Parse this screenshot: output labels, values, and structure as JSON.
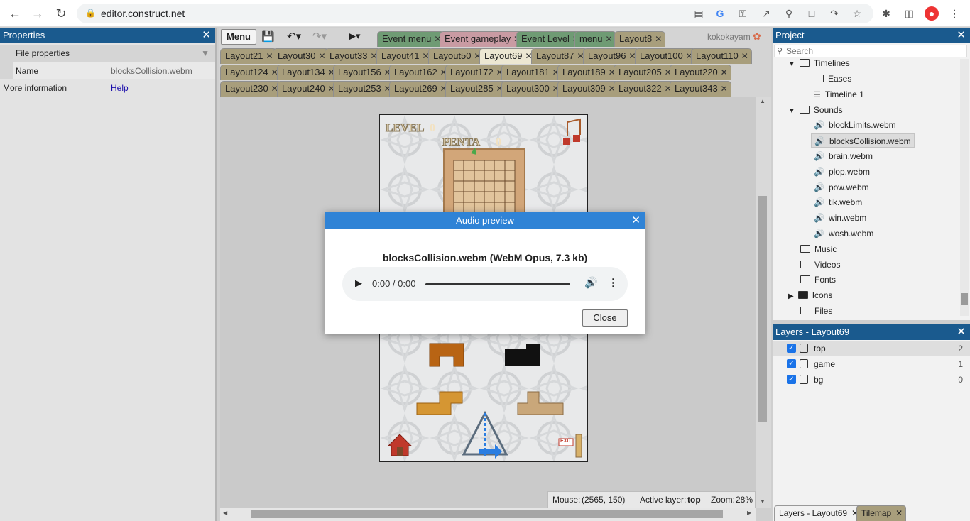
{
  "browser": {
    "url": "editor.construct.net",
    "nav": [
      "back-icon",
      "forward-icon",
      "reload-icon"
    ],
    "toolbar_icons": [
      "save-page-icon",
      "google-icon",
      "key-icon",
      "open-in-new-icon",
      "zoom-icon",
      "page-icon",
      "share-icon",
      "star-icon",
      "extensions-icon",
      "sidebar-icon",
      "profile-avatar"
    ]
  },
  "properties": {
    "title": "Properties",
    "section": "File properties",
    "name_label": "Name",
    "name_value": "blocksCollision.webm",
    "more_info_label": "More information",
    "help_link": "Help"
  },
  "toolbar": {
    "menu_label": "Menu",
    "user": "kokokayam"
  },
  "tabs": {
    "row1": [
      {
        "label": "Event menu",
        "kind": "event"
      },
      {
        "label": "Event gameplay",
        "kind": "event-pink"
      },
      {
        "label": "Event Level",
        "kind": "event"
      },
      {
        "label": "menu",
        "kind": "event"
      },
      {
        "label": "Layout8",
        "kind": "layout"
      }
    ],
    "row2": [
      "Layout21",
      "Layout30",
      "Layout33",
      "Layout41",
      "Layout50",
      "Layout69",
      "Layout87",
      "Layout96",
      "Layout100",
      "Layout110"
    ],
    "row3": [
      "Layout124",
      "Layout134",
      "Layout156",
      "Layout162",
      "Layout172",
      "Layout181",
      "Layout189",
      "Layout205",
      "Layout220"
    ],
    "row4": [
      "Layout230",
      "Layout240",
      "Layout253",
      "Layout269",
      "Layout285",
      "Layout300",
      "Layout309",
      "Layout322",
      "Layout343"
    ],
    "active": "Layout69"
  },
  "layout_view": {
    "level_text": "LEVEL",
    "level_value": "0",
    "penta_text": "PENTA",
    "penta_value": "0",
    "exit_text": "EXIT"
  },
  "status": {
    "mouse_label": "Mouse:",
    "mouse_value": "(2565, 150)",
    "layer_label": "Active layer:",
    "layer_value": "top",
    "zoom_label": "Zoom:",
    "zoom_value": "28%"
  },
  "project": {
    "title": "Project",
    "search_placeholder": "Search",
    "items": [
      {
        "label": "Timelines",
        "type": "folder",
        "expanded": true
      },
      {
        "label": "Eases",
        "type": "folder"
      },
      {
        "label": "Timeline 1",
        "type": "timeline"
      },
      {
        "label": "Sounds",
        "type": "folder",
        "expanded": true
      },
      {
        "label": "blockLimits.webm",
        "type": "sound"
      },
      {
        "label": "blocksCollision.webm",
        "type": "sound",
        "selected": true
      },
      {
        "label": "brain.webm",
        "type": "sound"
      },
      {
        "label": "plop.webm",
        "type": "sound"
      },
      {
        "label": "pow.webm",
        "type": "sound"
      },
      {
        "label": "tik.webm",
        "type": "sound"
      },
      {
        "label": "win.webm",
        "type": "sound"
      },
      {
        "label": "wosh.webm",
        "type": "sound"
      },
      {
        "label": "Music",
        "type": "folder"
      },
      {
        "label": "Videos",
        "type": "folder"
      },
      {
        "label": "Fonts",
        "type": "folder"
      },
      {
        "label": "Icons",
        "type": "folder",
        "collapsed": true
      },
      {
        "label": "Files",
        "type": "folder"
      }
    ]
  },
  "layers": {
    "title": "Layers - Layout69",
    "rows": [
      {
        "name": "top",
        "index": "2"
      },
      {
        "name": "game",
        "index": "1"
      },
      {
        "name": "bg",
        "index": "0"
      }
    ],
    "bottom_tabs": [
      "Layers - Layout69",
      "Tilemap"
    ]
  },
  "dialog": {
    "title": "Audio preview",
    "file_info": "blocksCollision.webm (WebM Opus, 7.3 kb)",
    "time": "0:00 / 0:00",
    "close_label": "Close"
  }
}
